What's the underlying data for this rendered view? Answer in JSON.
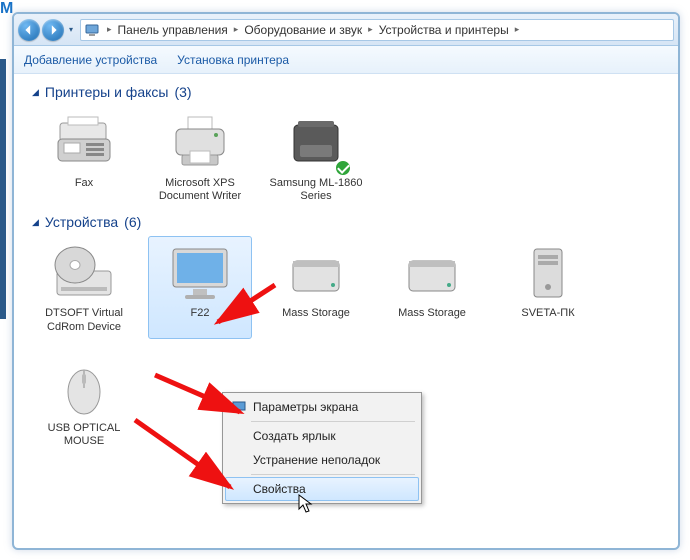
{
  "breadcrumb": {
    "root": "Панель управления",
    "mid": "Оборудование и звук",
    "leaf": "Устройства и принтеры"
  },
  "toolbar": {
    "add_device": "Добавление устройства",
    "add_printer": "Установка принтера"
  },
  "groups": {
    "printers": {
      "title": "Принтеры и факсы",
      "count": "(3)"
    },
    "devices": {
      "title": "Устройства",
      "count": "(6)"
    }
  },
  "printers": [
    {
      "label": "Fax"
    },
    {
      "label": "Microsoft XPS Document Writer"
    },
    {
      "label": "Samsung ML-1860 Series",
      "default": true
    }
  ],
  "devices": [
    {
      "label": "DTSOFT Virtual CdRom Device"
    },
    {
      "label": "F22",
      "selected": true
    },
    {
      "label": "Mass Storage"
    },
    {
      "label": "Mass Storage"
    },
    {
      "label": "SVETA-ПК"
    },
    {
      "label": "USB OPTICAL MOUSE"
    }
  ],
  "context_menu": {
    "display_settings": "Параметры экрана",
    "create_shortcut": "Создать ярлык",
    "troubleshoot": "Устранение неполадок",
    "properties": "Свойства"
  },
  "watermark": "M"
}
